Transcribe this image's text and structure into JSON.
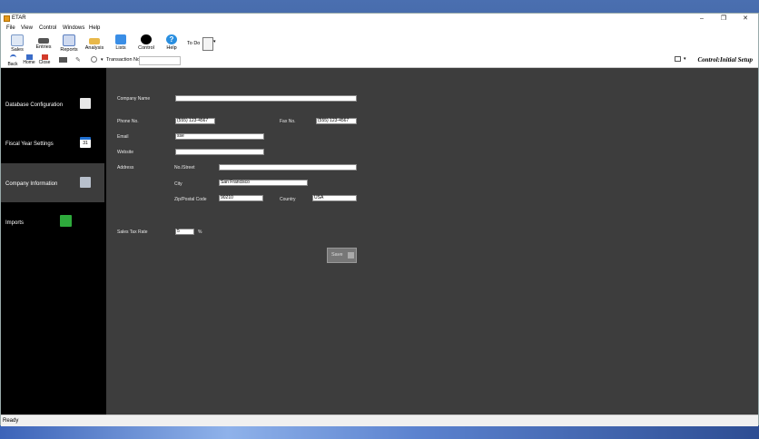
{
  "window": {
    "title": "ETAR",
    "minimize": "–",
    "maximize": "❐",
    "close": "✕"
  },
  "menu": [
    "File",
    "View",
    "Control",
    "Windows",
    "Help"
  ],
  "toolbar": {
    "sales": "Sales",
    "entries": "Entries",
    "reports": "Reports",
    "analysis": "Analysis",
    "lists": "Lists",
    "control": "Control",
    "help": "Help",
    "todo": "To Do"
  },
  "nav": {
    "back": "Back",
    "home": "Home",
    "close": "Close",
    "transaction_label": "Transaction No.",
    "transaction_value": ""
  },
  "breadcrumb": "Control:Initial Setup",
  "sidebar": [
    {
      "label": "Database Configuration",
      "icon": "database-icon"
    },
    {
      "label": "Fiscal Year Settings",
      "icon": "calendar-icon",
      "day": "31"
    },
    {
      "label": "Company Information",
      "icon": "company-icon"
    },
    {
      "label": "Imports",
      "icon": "imports-icon"
    }
  ],
  "form": {
    "company_name_label": "Company Name",
    "company_name": "",
    "phone_label": "Phone No.",
    "phone": "(555) 123-4567",
    "fax_label": "Fax No.",
    "fax": "(555) 123-4567",
    "email_label": "Email",
    "email": "sse",
    "website_label": "Website",
    "website": "",
    "address_label": "Address",
    "street_label": "No./Street",
    "street": "",
    "city_label": "City",
    "city": "San Francisco",
    "zip_label": "Zip/Postal Code",
    "zip": "90210",
    "country_label": "Country",
    "country": "USA",
    "tax_label": "Sales Tax Rate",
    "tax": "5",
    "tax_unit": "%",
    "save_label": "Save"
  },
  "status": "Ready",
  "colors": {
    "sales": "#3a7bd5",
    "lists": "#3a8ee6",
    "help": "#2a8fe0",
    "fiscal": "#1f6fd0",
    "imports": "#2eaa3c"
  }
}
